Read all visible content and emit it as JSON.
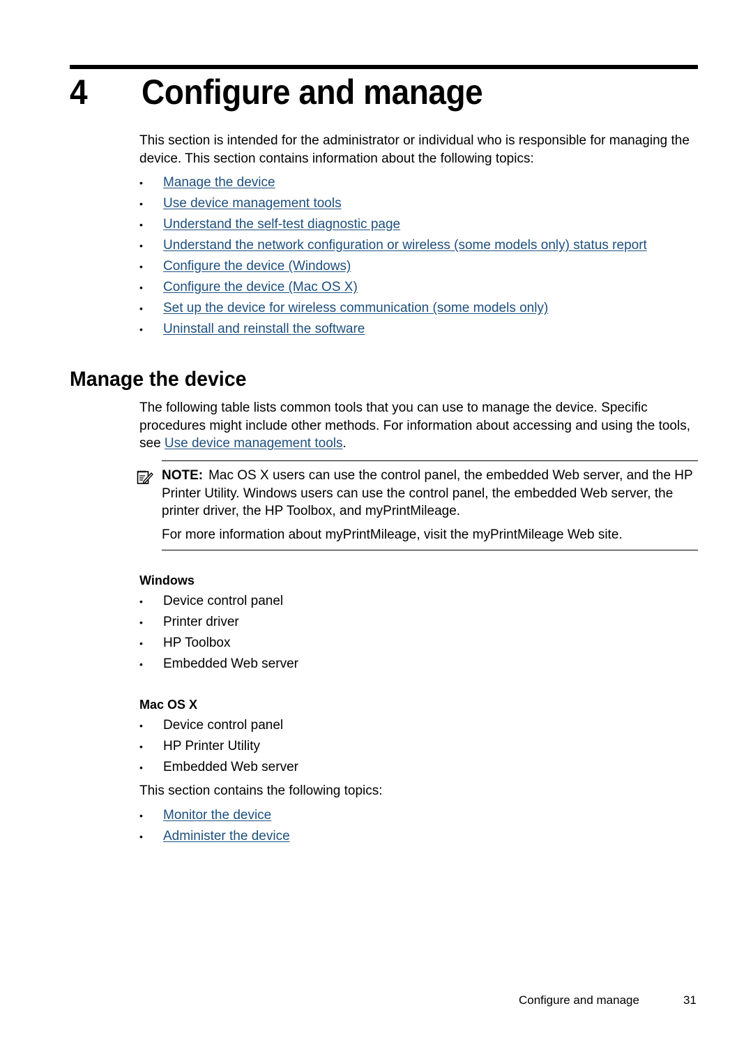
{
  "chapter": {
    "number": "4",
    "title": "Configure and manage",
    "intro": "This section is intended for the administrator or individual who is responsible for managing the device. This section contains information about the following topics:",
    "topics": [
      "Manage the device",
      "Use device management tools",
      "Understand the self-test diagnostic page",
      "Understand the network configuration or wireless (some models only) status report",
      "Configure the device (Windows)",
      "Configure the device (Mac OS X)",
      "Set up the device for wireless communication (some models only)",
      "Uninstall and reinstall the software"
    ]
  },
  "section": {
    "title": "Manage the device",
    "description_before_link": "The following table lists common tools that you can use to manage the device. Specific procedures might include other methods. For information about accessing and using the tools, see ",
    "description_link": "Use device management tools",
    "description_after_link": ".",
    "note": {
      "icon": "note-pencil-icon",
      "label": "NOTE:",
      "text": "Mac OS X users can use the control panel, the embedded Web server, and the HP Printer Utility. Windows users can use the control panel, the embedded Web server, the printer driver, the HP Toolbox, and myPrintMileage.",
      "more": "For more information about myPrintMileage, visit the myPrintMileage Web site."
    },
    "windows": {
      "heading": "Windows",
      "items": [
        "Device control panel",
        "Printer driver",
        "HP Toolbox",
        "Embedded Web server"
      ]
    },
    "mac": {
      "heading": "Mac OS X",
      "items": [
        "Device control panel",
        "HP Printer Utility",
        "Embedded Web server"
      ]
    },
    "topics_intro": "This section contains the following topics:",
    "topics": [
      "Monitor the device",
      "Administer the device"
    ]
  },
  "footer": {
    "title": "Configure and manage",
    "page": "31"
  },
  "bullet_char": "•",
  "colors": {
    "link": "#1d4f7e",
    "text": "#000000"
  }
}
